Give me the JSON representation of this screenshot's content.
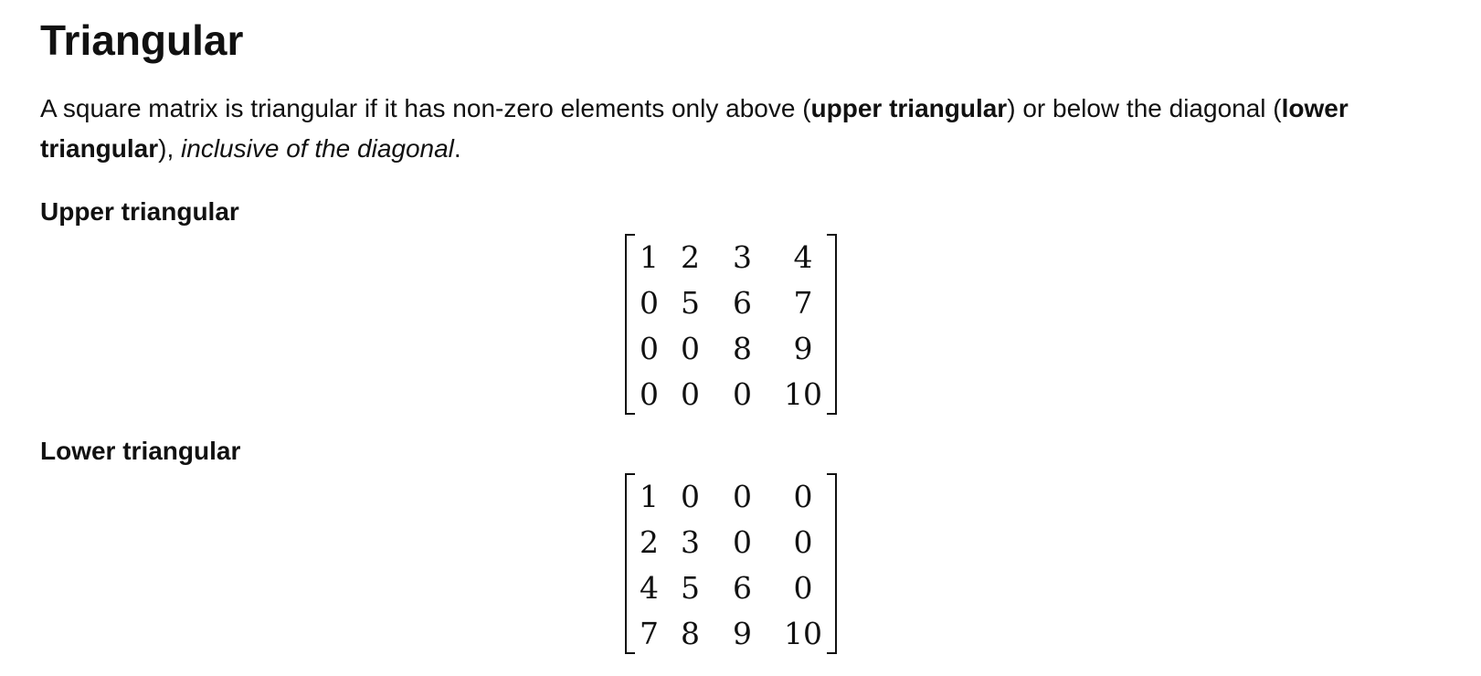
{
  "title": "Triangular",
  "intro": {
    "p1": "A square matrix is triangular if it has non-zero elements only above (",
    "upper_term": "upper triangular",
    "p2": ") or below the diagonal (",
    "lower_term": "lower triangular",
    "p3": "), ",
    "emphasis": "inclusive of the diagonal",
    "p4": "."
  },
  "upper": {
    "heading": "Upper triangular",
    "matrix": [
      [
        "1",
        "2",
        "3",
        "4"
      ],
      [
        "0",
        "5",
        "6",
        "7"
      ],
      [
        "0",
        "0",
        "8",
        "9"
      ],
      [
        "0",
        "0",
        "0",
        "10"
      ]
    ]
  },
  "lower": {
    "heading": "Lower triangular",
    "matrix": [
      [
        "1",
        "0",
        "0",
        "0"
      ],
      [
        "2",
        "3",
        "0",
        "0"
      ],
      [
        "4",
        "5",
        "6",
        "0"
      ],
      [
        "7",
        "8",
        "9",
        "10"
      ]
    ]
  }
}
